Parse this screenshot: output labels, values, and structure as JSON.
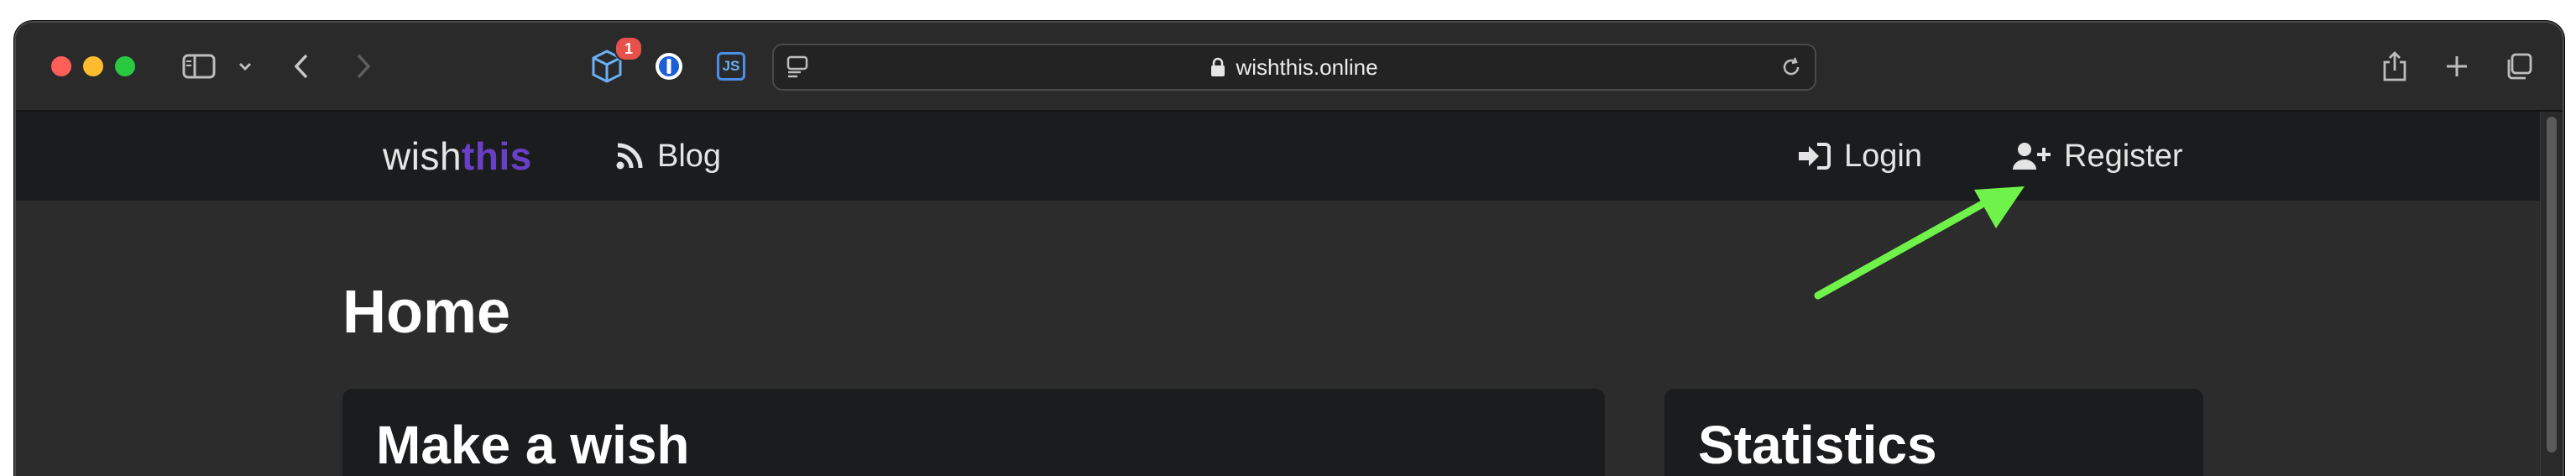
{
  "browser": {
    "traffic_lights": {
      "close": "#ff5f57",
      "minimize": "#febc2e",
      "zoom": "#28c840"
    },
    "toolbar_icons": [
      "sidebar-icon",
      "chevron-down-icon",
      "back-icon",
      "forward-icon"
    ],
    "extensions": [
      {
        "icon": "box-extension-icon",
        "badge": "1"
      },
      {
        "icon": "password-manager-icon"
      },
      {
        "icon": "js-extension-icon",
        "label": "JS"
      }
    ],
    "url": "wishthis.online",
    "right_icons": [
      "share-icon",
      "new-tab-icon",
      "tabs-overview-icon"
    ]
  },
  "site": {
    "logo": {
      "prefix": "wish",
      "suffix": "this"
    },
    "nav": {
      "blog": "Blog",
      "login": "Login",
      "register": "Register"
    },
    "page_title": "Home",
    "cards": {
      "make_a_wish": "Make a wish",
      "statistics": "Statistics"
    }
  },
  "annotation": {
    "color": "#6ff34a",
    "points_to": "register"
  }
}
